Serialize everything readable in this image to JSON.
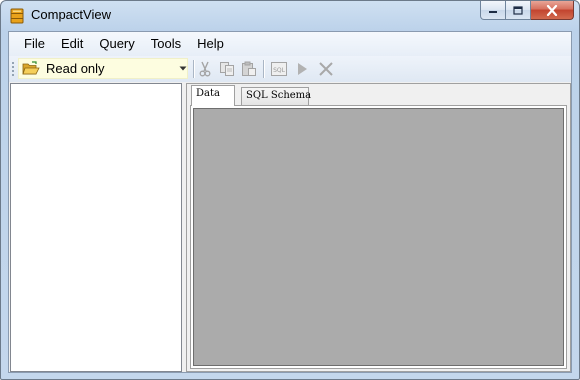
{
  "window": {
    "title": "CompactView",
    "app_icon": "database-icon",
    "buttons": [
      "minimize-icon",
      "maximize-icon",
      "close-icon"
    ]
  },
  "menubar": {
    "items": [
      "File",
      "Edit",
      "Query",
      "Tools",
      "Help"
    ]
  },
  "toolbar": {
    "mode_combo": {
      "value": "Read only",
      "icon": "open-folder-icon"
    },
    "buttons": [
      "cut-icon",
      "copy-icon",
      "paste-icon",
      "sql-icon",
      "run-icon",
      "cancel-icon"
    ]
  },
  "tabs": [
    "Data",
    "SQL Schema"
  ],
  "active_tab": "Data",
  "colors": {
    "combo_bg": "#fdfde0",
    "grid_bg": "#ababab",
    "close_button": "#c2442f"
  }
}
